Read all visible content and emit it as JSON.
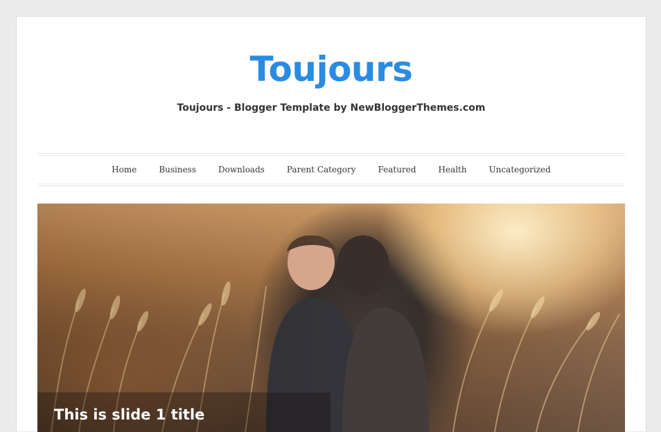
{
  "header": {
    "site_title": "Toujours",
    "tagline": "Toujours - Blogger Template by NewBloggerThemes.com",
    "accent_color": "#2a8be2"
  },
  "nav": {
    "items": [
      {
        "label": "Home"
      },
      {
        "label": "Business"
      },
      {
        "label": "Downloads"
      },
      {
        "label": "Parent Category"
      },
      {
        "label": "Featured"
      },
      {
        "label": "Health"
      },
      {
        "label": "Uncategorized"
      }
    ]
  },
  "slider": {
    "slide_title": "This is slide 1 title",
    "image_description_icon": "photo-couple-in-wheat-field"
  }
}
